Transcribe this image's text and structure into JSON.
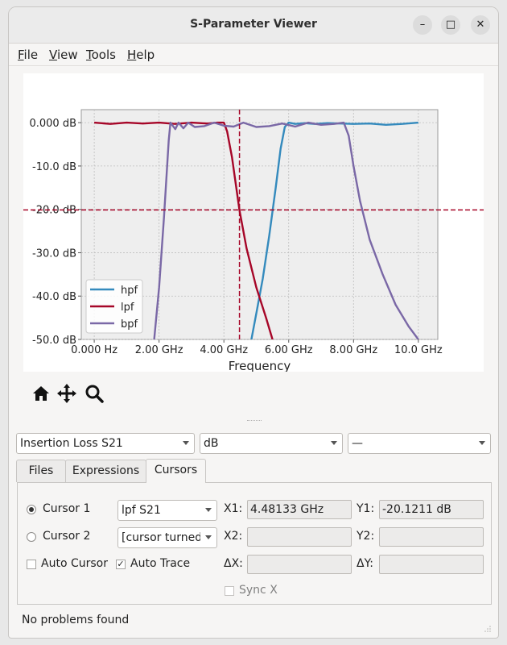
{
  "window": {
    "title": "S-Parameter Viewer",
    "buttons": [
      "–",
      "□",
      "✕"
    ]
  },
  "menu": [
    {
      "accel": "F",
      "rest": "ile"
    },
    {
      "accel": "V",
      "rest": "iew"
    },
    {
      "accel": "T",
      "rest": "ools"
    },
    {
      "accel": "H",
      "rest": "elp"
    }
  ],
  "chart_data": {
    "type": "line",
    "xlabel": "Frequency",
    "ylabel": "",
    "xlim": [
      -0.4,
      10.6
    ],
    "ylim": [
      -50,
      3
    ],
    "x_ticks": [
      "0.000 Hz",
      "2.00 GHz",
      "4.00 GHz",
      "6.00 GHz",
      "8.00 GHz",
      "10.0 GHz"
    ],
    "x_tick_values": [
      0,
      2,
      4,
      6,
      8,
      10
    ],
    "y_ticks": [
      "0.000 dB",
      "-10.0 dB",
      "-20.0 dB",
      "-30.0 dB",
      "-40.0 dB",
      "-50.0 dB"
    ],
    "y_tick_values": [
      0,
      -10,
      -20,
      -30,
      -40,
      -50
    ],
    "grid": true,
    "legend_position": "lower-left",
    "series": [
      {
        "name": "hpf",
        "color": "#348abd",
        "x": [
          4.85,
          5.0,
          5.2,
          5.4,
          5.6,
          5.75,
          5.88,
          6.0,
          6.2,
          6.5,
          6.8,
          7.2,
          7.6,
          8.0,
          8.5,
          9.0,
          9.5,
          10.0
        ],
        "y": [
          -50,
          -44,
          -36,
          -26,
          -15,
          -6,
          -1,
          0,
          -0.3,
          -0.1,
          -0.3,
          -0.1,
          -0.2,
          -0.3,
          -0.2,
          -0.5,
          -0.3,
          0
        ]
      },
      {
        "name": "lpf",
        "color": "#a60628",
        "x": [
          0,
          0.5,
          1.0,
          1.5,
          2.0,
          2.5,
          3.0,
          3.5,
          3.8,
          4.0,
          4.1,
          4.25,
          4.48,
          4.7,
          5.0,
          5.3,
          5.5
        ],
        "y": [
          0,
          -0.3,
          0,
          -0.2,
          0,
          -0.3,
          0,
          -0.2,
          0,
          0,
          -2,
          -8,
          -20.12,
          -29,
          -38,
          -45,
          -50
        ]
      },
      {
        "name": "bpf",
        "color": "#7a68a6",
        "x": [
          1.85,
          2.0,
          2.15,
          2.3,
          2.35,
          2.5,
          2.6,
          2.75,
          2.9,
          3.1,
          3.4,
          3.7,
          4.0,
          4.3,
          4.6,
          5.0,
          5.4,
          5.8,
          6.2,
          6.6,
          7.0,
          7.4,
          7.7,
          7.85,
          8.0,
          8.2,
          8.5,
          8.9,
          9.3,
          9.7,
          10.0
        ],
        "y": [
          -50,
          -38,
          -22,
          -4,
          0,
          -1.5,
          0,
          -1.3,
          0,
          -1.0,
          -0.8,
          0,
          -0.7,
          -0.9,
          0,
          -1.0,
          -0.8,
          -0.2,
          -0.9,
          0,
          -0.5,
          -0.3,
          0,
          -3,
          -10,
          -18,
          -27,
          -35,
          -42,
          -47,
          -50
        ]
      }
    ],
    "cursor": {
      "x": 4.48133,
      "y": -20.1211,
      "color": "#a60628"
    }
  },
  "toolbar": {
    "home_icon": "home-icon",
    "pan_icon": "pan-icon",
    "zoom_icon": "zoom-icon"
  },
  "selectors": {
    "parameter": "Insertion Loss S21",
    "unit": "dB",
    "third": "—"
  },
  "tabs": [
    {
      "label": "Files",
      "active": false
    },
    {
      "label": "Expressions",
      "active": false
    },
    {
      "label": "Cursors",
      "active": true
    }
  ],
  "cursors": {
    "cursor1_label": "Cursor 1",
    "cursor1_trace": "lpf S21",
    "cursor2_label": "Cursor 2",
    "cursor2_trace": "[cursor turned off]",
    "x1_label": "X1:",
    "x1_value": "4.48133 GHz",
    "y1_label": "Y1:",
    "y1_value": "-20.1211 dB",
    "x2_label": "X2:",
    "x2_value": "",
    "y2_label": "Y2:",
    "y2_value": "",
    "auto_cursor_label": "Auto Cursor",
    "auto_trace_label": "Auto Trace",
    "dx_label": "ΔX:",
    "dx_value": "",
    "dy_label": "ΔY:",
    "dy_value": "",
    "sync_x_label": "Sync X"
  },
  "status": "No problems found"
}
